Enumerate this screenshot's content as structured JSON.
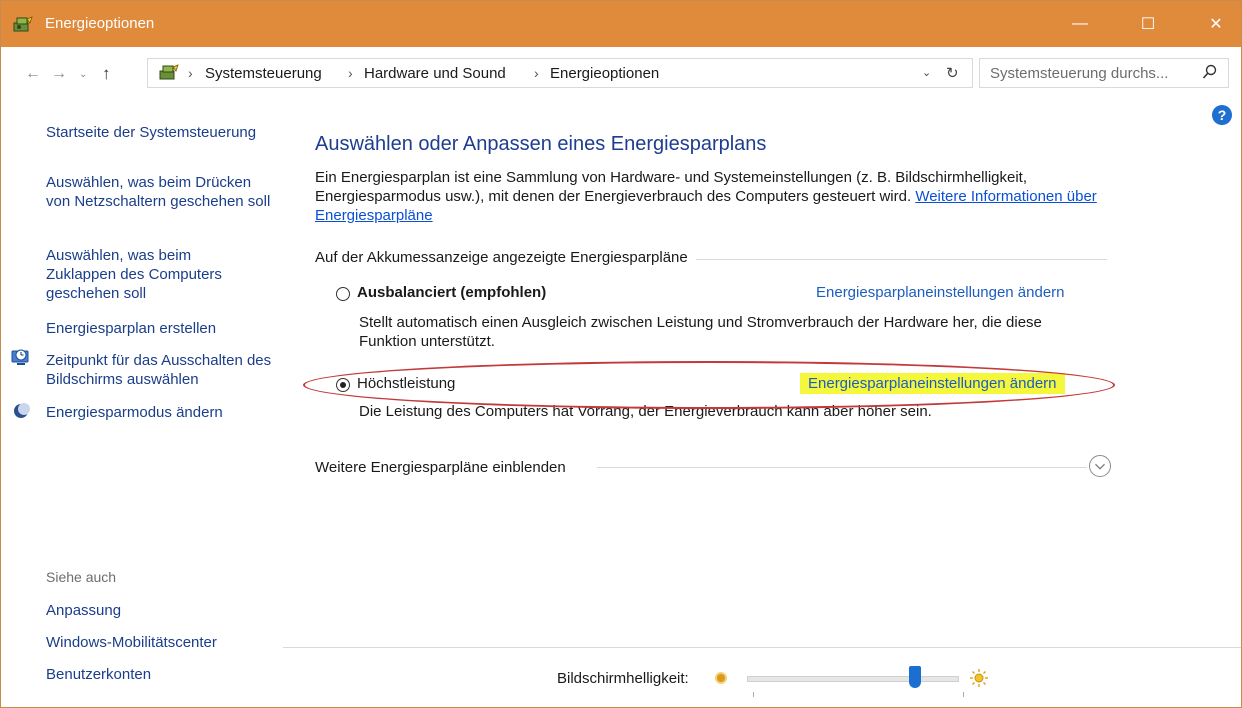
{
  "window": {
    "title": "Energieoptionen",
    "minimize_label": "—",
    "maximize_label": "☐",
    "close_label": "✕"
  },
  "address_bar": {
    "back_label": "←",
    "forward_label": "→",
    "recent_label": "⌄",
    "up_label": "↑",
    "breadcrumbs": [
      "Systemsteuerung",
      "Hardware und Sound",
      "Energieoptionen"
    ],
    "separator": "›",
    "dropdown_label": "⌄",
    "refresh_label": "↻",
    "search_placeholder": "Systemsteuerung durchs..."
  },
  "help": {
    "label": "?"
  },
  "sidebar": {
    "links": [
      "Startseite der Systemsteuerung",
      "Auswählen, was beim Drücken von Netzschaltern geschehen soll",
      "Auswählen, was beim Zuklappen des Computers geschehen soll",
      "Energiesparplan erstellen",
      "Zeitpunkt für das Ausschalten des Bildschirms auswählen",
      "Energiesparmodus ändern"
    ],
    "see_also_title": "Siehe auch",
    "see_also_links": [
      "Anpassung",
      "Windows-Mobilitätscenter",
      "Benutzerkonten"
    ]
  },
  "main": {
    "heading": "Auswählen oder Anpassen eines Energiesparplans",
    "description": "Ein Energiesparplan ist eine Sammlung von Hardware- und Systemeinstellungen (z. B. Bildschirmhelligkeit, Energiesparmodus usw.), mit denen der Energieverbrauch des Computers gesteuert wird.",
    "description_link": "Weitere Informationen über Energiesparpläne",
    "group_title": "Auf der Akkumessanzeige angezeigte Energiesparpläne",
    "plans": [
      {
        "name": "Ausbalanciert (empfohlen)",
        "selected": false,
        "link": "Energiesparplaneinstellungen ändern",
        "description": "Stellt automatisch einen Ausgleich zwischen Leistung und Stromverbrauch der Hardware her, die diese Funktion unterstützt."
      },
      {
        "name": "Höchstleistung",
        "selected": true,
        "link": "Energiesparplaneinstellungen ändern",
        "description": "Die Leistung des Computers hat Vorrang, der Energieverbrauch kann aber höher sein."
      }
    ],
    "more_plans": "Weitere Energiesparpläne einblenden",
    "highlight_color": "#f4f73c",
    "annotation_color": "#c23a3a"
  },
  "brightness": {
    "label": "Bildschirmhelligkeit:",
    "level": 0.8
  },
  "colors": {
    "titlebar": "#e08a3c",
    "link": "#1b3e8a",
    "heading": "#1e3d8f",
    "slider_thumb": "#1b6fd1"
  }
}
